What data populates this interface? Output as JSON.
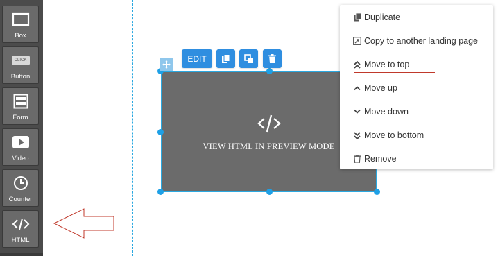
{
  "sidebar": {
    "items": [
      {
        "label": "Box",
        "icon": "box-icon"
      },
      {
        "label": "Button",
        "icon": "button-icon",
        "icon_text": "CLICK"
      },
      {
        "label": "Form",
        "icon": "form-icon"
      },
      {
        "label": "Video",
        "icon": "video-icon"
      },
      {
        "label": "Counter",
        "icon": "counter-icon"
      },
      {
        "label": "HTML",
        "icon": "code-icon"
      }
    ]
  },
  "toolbar": {
    "edit_label": "EDIT",
    "buttons": [
      "copy-icon",
      "layers-icon",
      "trash-icon"
    ]
  },
  "canvas": {
    "html_block_caption": "VIEW HTML IN PREVIEW MODE",
    "html_block_icon": "code-icon"
  },
  "context_menu": {
    "items": [
      {
        "label": "Duplicate",
        "icon": "copy-icon"
      },
      {
        "label": "Copy to another landing page",
        "icon": "export-icon"
      },
      {
        "label": "Move to top",
        "icon": "double-chevron-up-icon"
      },
      {
        "label": "Move up",
        "icon": "chevron-up-icon"
      },
      {
        "label": "Move down",
        "icon": "chevron-down-icon"
      },
      {
        "label": "Move to bottom",
        "icon": "double-chevron-down-icon"
      },
      {
        "label": "Remove",
        "icon": "trash-icon"
      }
    ]
  },
  "colors": {
    "accent": "#2f8ee0",
    "handle": "#1ea0e6",
    "sidebar_bg": "#4b4b4b",
    "block_bg": "#6b6b6b",
    "annotation": "#c0392b"
  }
}
